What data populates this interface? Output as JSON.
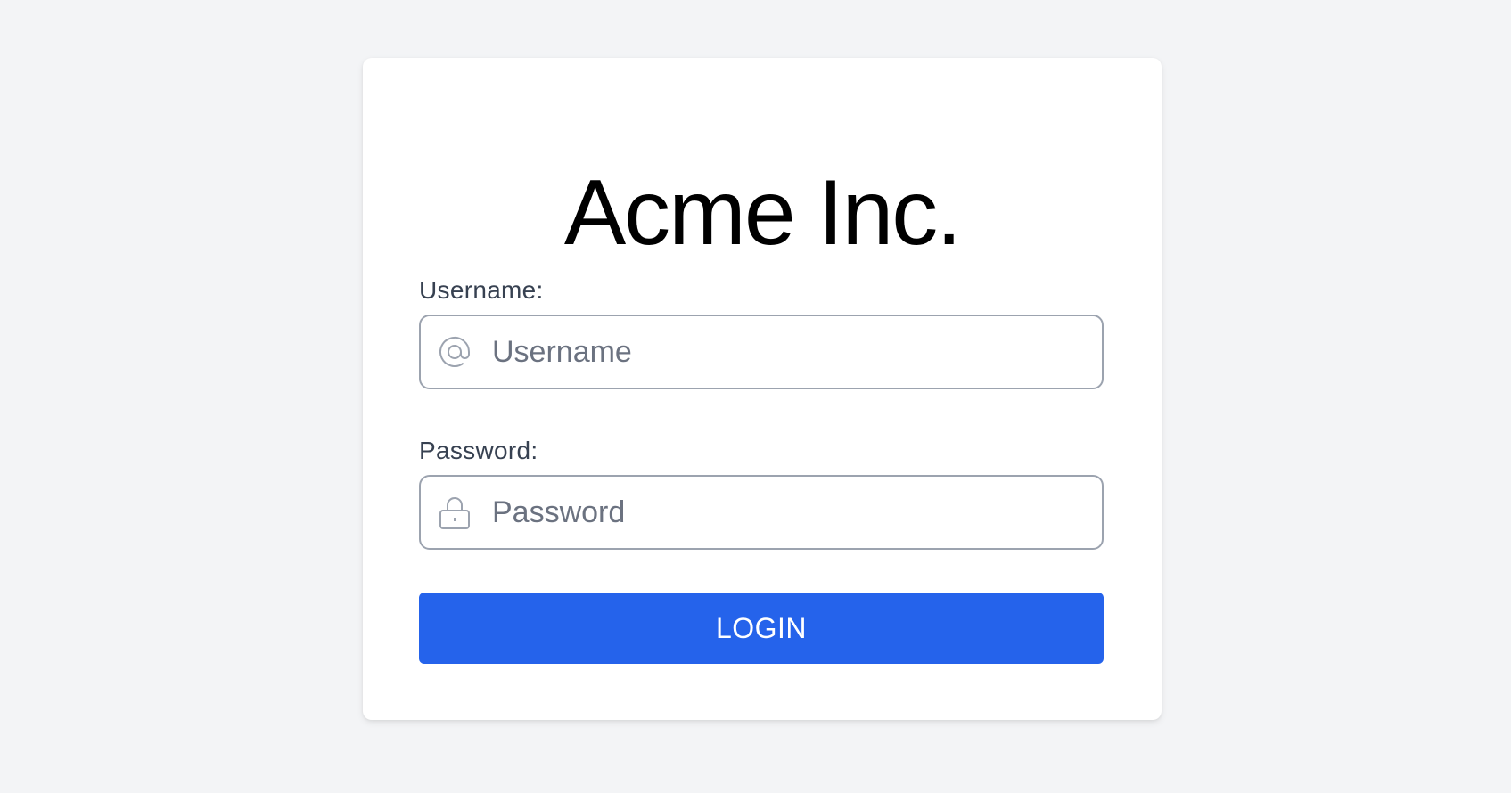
{
  "app": {
    "title": "Acme Inc."
  },
  "form": {
    "username": {
      "label": "Username:",
      "placeholder": "Username",
      "value": "",
      "icon": "at-sign-icon"
    },
    "password": {
      "label": "Password:",
      "placeholder": "Password",
      "value": "",
      "icon": "lock-icon"
    },
    "submit_label": "LOGIN"
  },
  "colors": {
    "background": "#f3f4f6",
    "card": "#ffffff",
    "primary": "#2563eb",
    "input_border": "#9ca3af",
    "label_text": "#374151",
    "placeholder_text": "#6b7280"
  }
}
